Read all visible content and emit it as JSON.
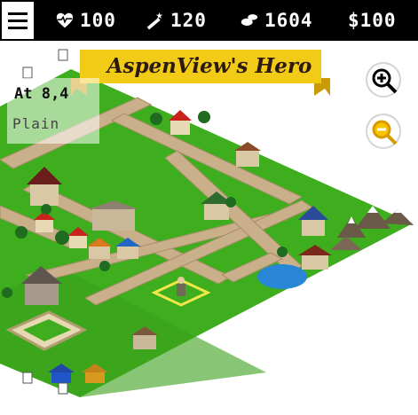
{
  "topbar": {
    "menu_icon": "hamburger-menu-icon",
    "stats": [
      {
        "icon": "heart-pulse-icon",
        "value": "100"
      },
      {
        "icon": "magic-wand-icon",
        "value": "120"
      },
      {
        "icon": "footprints-icon",
        "value": "1604"
      },
      {
        "icon": "dollar-icon",
        "value": "$100"
      }
    ]
  },
  "map": {
    "title": "AspenView's Hero",
    "coordinate": "At 8,4",
    "terrain": "Plain",
    "zoom_in_icon": "zoom-in-icon",
    "zoom_out_icon": "zoom-out-icon"
  },
  "colors": {
    "grass": "#3fae1e",
    "road": "#c9b08a",
    "banner": "#f2cb16",
    "zoom_out": "#f6c400"
  }
}
